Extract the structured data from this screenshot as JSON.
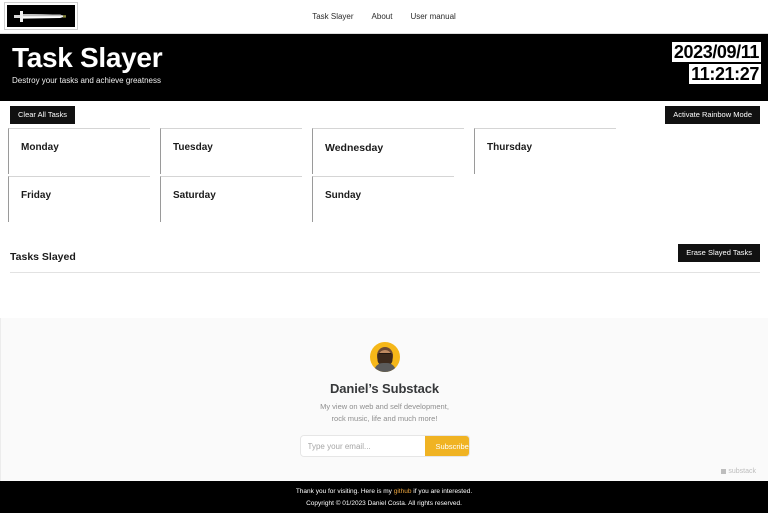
{
  "nav": {
    "logo_icon": "sword-icon",
    "links": [
      {
        "label": "Task Slayer"
      },
      {
        "label": "About"
      },
      {
        "label": "User manual"
      }
    ]
  },
  "hero": {
    "title": "Task Slayer",
    "subtitle": "Destroy your tasks and achieve greatness",
    "date": "2023/09/11",
    "time": "11:21:27"
  },
  "toolbar": {
    "clear_label": "Clear All Tasks",
    "rainbow_label": "Activate Rainbow Mode"
  },
  "days": [
    {
      "name": "Monday"
    },
    {
      "name": "Tuesday"
    },
    {
      "name": "Wednesday"
    },
    {
      "name": "Thursday"
    },
    {
      "name": "Friday"
    },
    {
      "name": "Saturday"
    },
    {
      "name": "Sunday"
    }
  ],
  "slayed": {
    "title": "Tasks Slayed",
    "erase_label": "Erase Slayed Tasks"
  },
  "substack": {
    "title": "Daniel’s Substack",
    "description_line1": "My view on web and self development,",
    "description_line2": "rock music, life and much more!",
    "email_placeholder": "Type your email...",
    "subscribe_label": "Subscribe",
    "brand_label": "substack"
  },
  "footer": {
    "thanks_prefix": "Thank you for visiting. Here is my ",
    "github_label": "github",
    "thanks_suffix": " if you are interested.",
    "copyright": "Copyright © 01/2023 Daniel Costa. All rights reserved."
  },
  "colors": {
    "accent_orange": "#f0b323",
    "link_orange": "#e8a33d",
    "black": "#000000",
    "substack_bg": "#fafafa"
  }
}
